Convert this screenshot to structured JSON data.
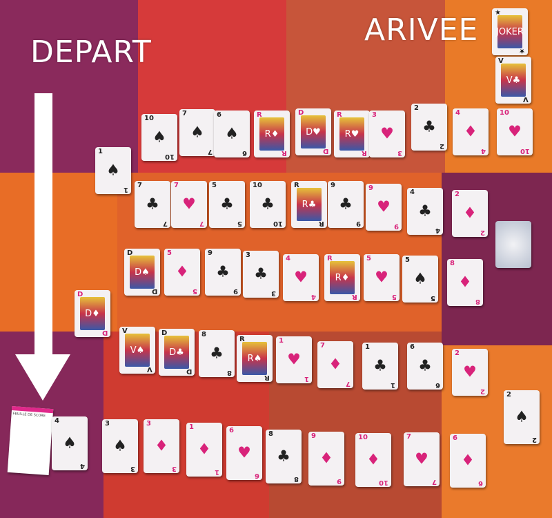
{
  "labels": {
    "start": "DEPART",
    "finish": "ARIVEE"
  },
  "score_sheet": {
    "title": "FEUILLE DE SCORE"
  },
  "colors": {
    "red_suit": "#d8237a",
    "black_suit": "#222222",
    "arrow": "#ffffff"
  },
  "cards": [
    {
      "rank": "JOKER",
      "suit": ""
    },
    {
      "rank": "V",
      "suit": "♣"
    },
    {
      "rank": "10",
      "suit": "♠"
    },
    {
      "rank": "7",
      "suit": "♠"
    },
    {
      "rank": "6",
      "suit": "♠"
    },
    {
      "rank": "R",
      "suit": "♦"
    },
    {
      "rank": "D",
      "suit": "♥"
    },
    {
      "rank": "R",
      "suit": "♥"
    },
    {
      "rank": "3",
      "suit": "♥"
    },
    {
      "rank": "2",
      "suit": "♣"
    },
    {
      "rank": "4",
      "suit": "♦"
    },
    {
      "rank": "10",
      "suit": "♥"
    },
    {
      "rank": "1",
      "suit": "♠"
    },
    {
      "rank": "7",
      "suit": "♣"
    },
    {
      "rank": "7",
      "suit": "♥"
    },
    {
      "rank": "5",
      "suit": "♣"
    },
    {
      "rank": "10",
      "suit": "♣"
    },
    {
      "rank": "R",
      "suit": "♣"
    },
    {
      "rank": "9",
      "suit": "♣"
    },
    {
      "rank": "9",
      "suit": "♥"
    },
    {
      "rank": "4",
      "suit": "♣"
    },
    {
      "rank": "2",
      "suit": "♦"
    },
    {
      "rank": "",
      "suit": "back"
    },
    {
      "rank": "D",
      "suit": "♠"
    },
    {
      "rank": "5",
      "suit": "♦"
    },
    {
      "rank": "9",
      "suit": "♣"
    },
    {
      "rank": "3",
      "suit": "♣"
    },
    {
      "rank": "4",
      "suit": "♥"
    },
    {
      "rank": "R",
      "suit": "♦"
    },
    {
      "rank": "5",
      "suit": "♥"
    },
    {
      "rank": "5",
      "suit": "♠"
    },
    {
      "rank": "8",
      "suit": "♦"
    },
    {
      "rank": "D",
      "suit": "♦"
    },
    {
      "rank": "V",
      "suit": "♠"
    },
    {
      "rank": "D",
      "suit": "♣"
    },
    {
      "rank": "8",
      "suit": "♣"
    },
    {
      "rank": "R",
      "suit": "♠"
    },
    {
      "rank": "1",
      "suit": "♥"
    },
    {
      "rank": "7",
      "suit": "♦"
    },
    {
      "rank": "1",
      "suit": "♣"
    },
    {
      "rank": "6",
      "suit": "♣"
    },
    {
      "rank": "2",
      "suit": "♥"
    },
    {
      "rank": "2",
      "suit": "♠"
    },
    {
      "rank": "4",
      "suit": "♠"
    },
    {
      "rank": "3",
      "suit": "♠"
    },
    {
      "rank": "3",
      "suit": "♦"
    },
    {
      "rank": "1",
      "suit": "♦"
    },
    {
      "rank": "6",
      "suit": "♥"
    },
    {
      "rank": "8",
      "suit": "♣"
    },
    {
      "rank": "9",
      "suit": "♦"
    },
    {
      "rank": "10",
      "suit": "♦"
    },
    {
      "rank": "7",
      "suit": "♥"
    },
    {
      "rank": "6",
      "suit": "♦"
    }
  ]
}
